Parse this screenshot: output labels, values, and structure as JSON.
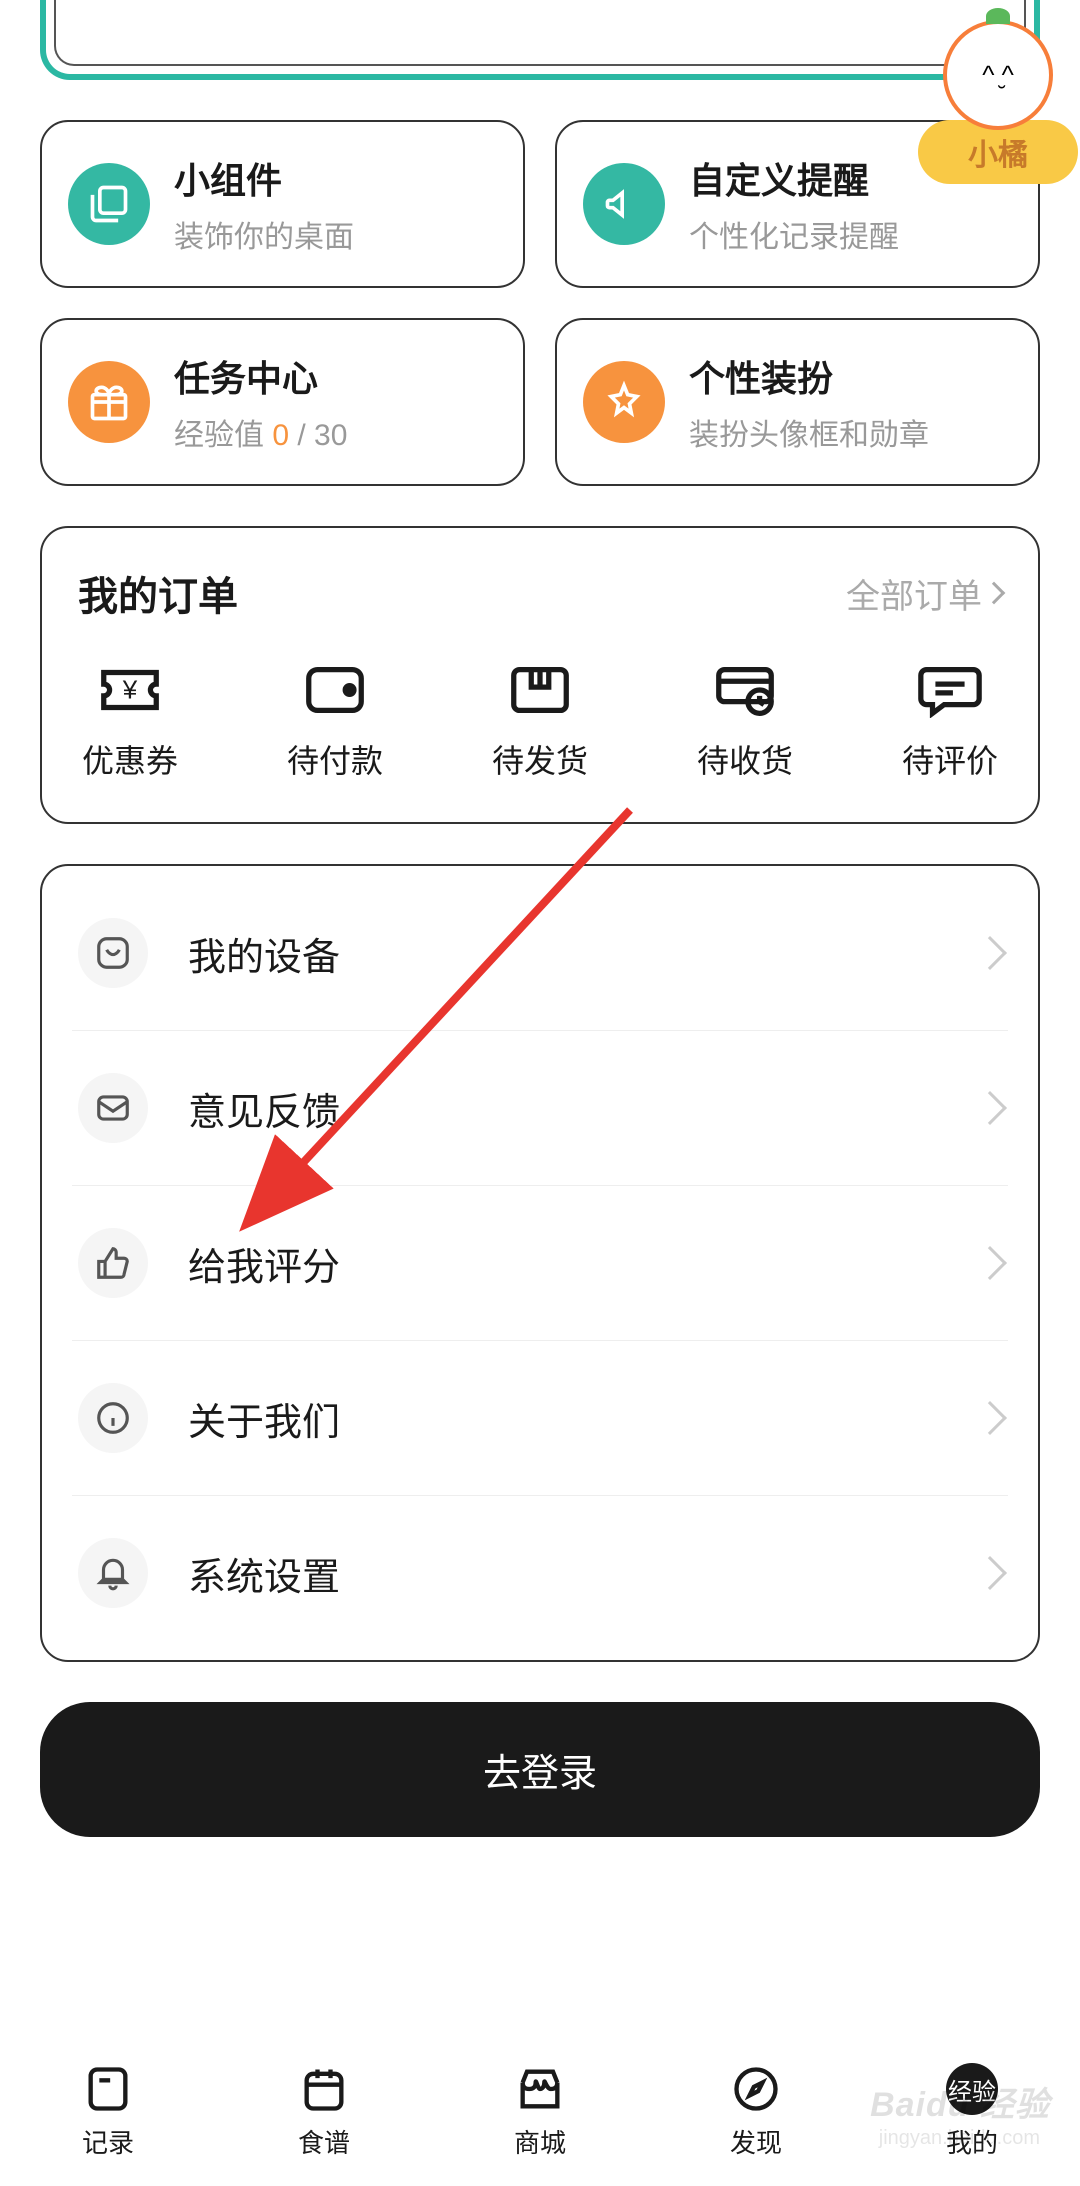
{
  "mascot": {
    "label": "小橘"
  },
  "featureCards": [
    {
      "title": "小组件",
      "subtitle": "装饰你的桌面"
    },
    {
      "title": "自定义提醒",
      "subtitle": "个性化记录提醒"
    },
    {
      "title": "任务中心",
      "subtitle_prefix": "经验值 ",
      "exp_current": "0",
      "exp_sep": " / ",
      "exp_total": "30"
    },
    {
      "title": "个性装扮",
      "subtitle": "装扮头像框和勋章"
    }
  ],
  "orders": {
    "title": "我的订单",
    "allLabel": "全部订单",
    "items": [
      "优惠券",
      "待付款",
      "待发货",
      "待收货",
      "待评价"
    ]
  },
  "settings": {
    "items": [
      "我的设备",
      "意见反馈",
      "给我评分",
      "关于我们",
      "系统设置"
    ]
  },
  "loginButton": "去登录",
  "bottomNav": {
    "items": [
      "记录",
      "食谱",
      "商城",
      "发现",
      "我的"
    ],
    "activeBadge": "经验"
  },
  "watermark": {
    "main": "Baidu 经验",
    "sub": "jingyan.baidu.com"
  }
}
